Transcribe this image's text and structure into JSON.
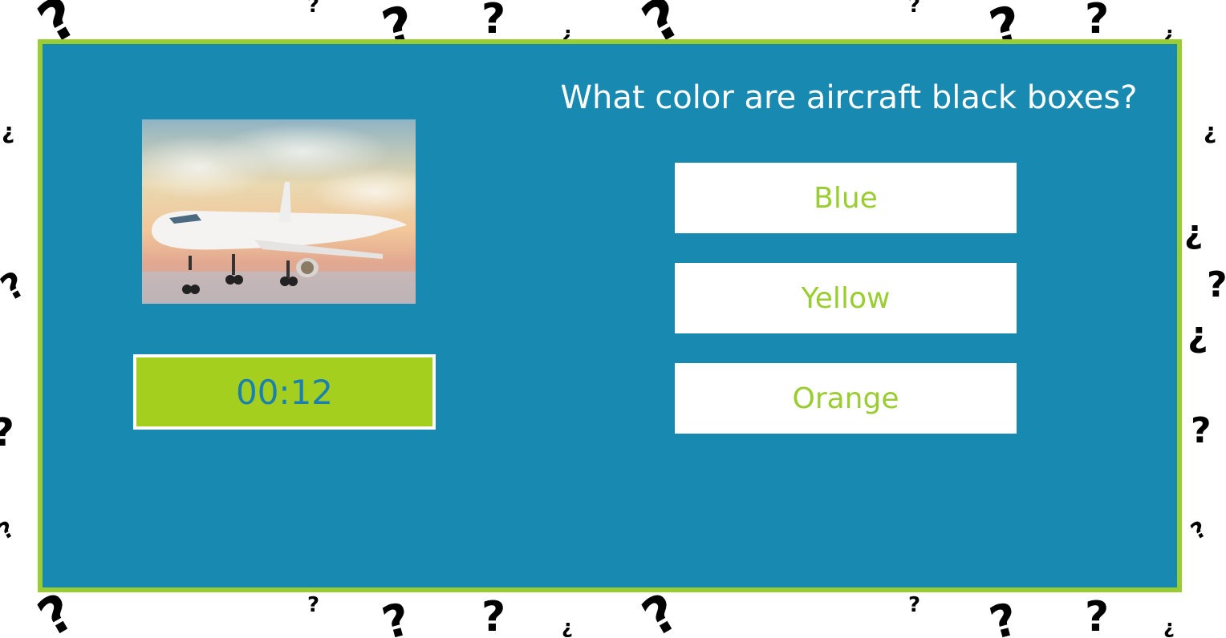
{
  "quiz": {
    "question": "What color are aircraft black boxes?",
    "timer": "00:12",
    "answers": [
      "Blue",
      "Yellow",
      "Orange"
    ],
    "image_subject": "airplane-photo"
  },
  "colors": {
    "panel_background": "#1889b1",
    "panel_border": "#9acd32",
    "timer_background": "#a5cf1e",
    "timer_text": "#1a80b0",
    "answer_text": "#9acd32",
    "answer_background": "#ffffff",
    "question_text": "#ffffff"
  },
  "background": {
    "pattern_icon": "question-mark-icon"
  }
}
